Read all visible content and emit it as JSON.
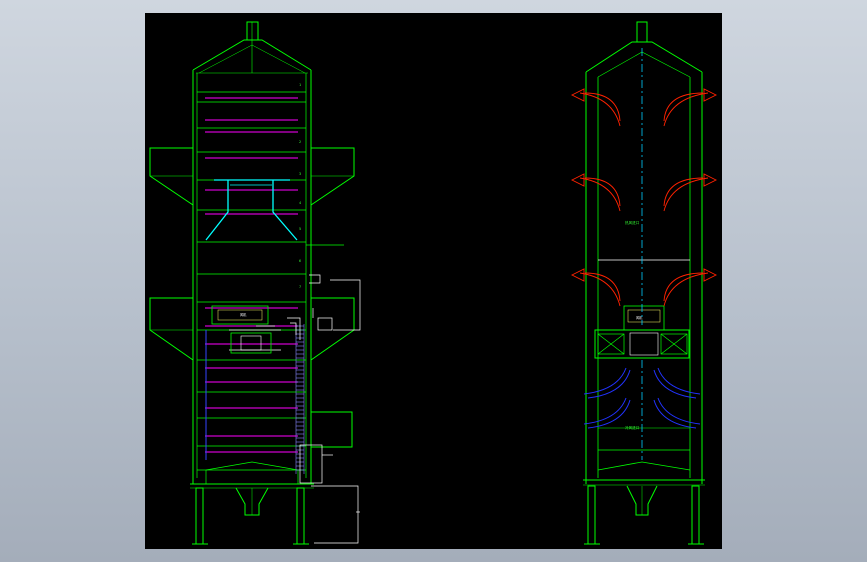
{
  "drawing": {
    "elevation_numbers": [
      "1",
      "2",
      "3",
      "4",
      "5",
      "6",
      "7"
    ],
    "box_tags": [
      "风机",
      "风机"
    ],
    "side_notes": [
      "热风进口",
      "冷风进口"
    ],
    "colors": {
      "background": "#000000",
      "structure": "#00ff00",
      "pipe": "#ff00ff",
      "duct": "#00ffff",
      "hot_air": "#ff2200",
      "cold_air": "#2233ff",
      "axis": "#00ccff",
      "aux": "#ffffff",
      "hatch": "#8888ff"
    }
  }
}
